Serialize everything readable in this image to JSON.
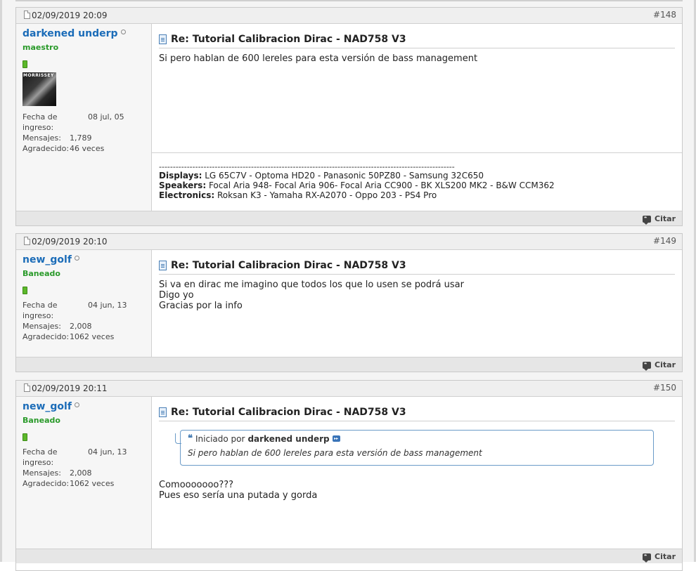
{
  "posts": [
    {
      "date": "02/09/2019 20:09",
      "number": "#148",
      "username": "darkened underp",
      "rank": "maestro",
      "info": [
        {
          "label": "Fecha de ingreso:",
          "value": "08 jul, 05"
        },
        {
          "label": "Mensajes:",
          "value": "1,789"
        },
        {
          "label": "Agradecido:",
          "value": "46 veces"
        }
      ],
      "avatar_text": "MORRISSEY",
      "title": "Re: Tutorial Calibracion Dirac - NAD758 V3",
      "message": [
        "Si pero hablan de 600 lereles para esta versión de bass management"
      ],
      "signature": {
        "divider": "----------------------------------------------------------------------------------------------------------",
        "lines": [
          {
            "label": "Displays:",
            "value": "LG 65C7V - Optoma HD20 - Panasonic 50PZ80 - Samsung 32C650"
          },
          {
            "label": "Speakers:",
            "value": "Focal Aria 948- Focal Aria 906- Focal Aria CC900 - BK XLS200 MK2 - B&W CCM362"
          },
          {
            "label": "Electronics:",
            "value": "Roksan K3 - Yamaha RX-A2070 - Oppo 203 - PS4 Pro"
          }
        ]
      },
      "cite": "Citar"
    },
    {
      "date": "02/09/2019 20:10",
      "number": "#149",
      "username": "new_golf",
      "rank": "Baneado",
      "info": [
        {
          "label": "Fecha de ingreso:",
          "value": "04 jun, 13"
        },
        {
          "label": "Mensajes:",
          "value": "2,008"
        },
        {
          "label": "Agradecido:",
          "value": "1062 veces"
        }
      ],
      "title": "Re: Tutorial Calibracion Dirac - NAD758 V3",
      "message": [
        "Si va en dirac me imagino que todos los que lo usen se podrá usar",
        "Digo yo",
        "Gracias por la info"
      ],
      "cite": "Citar"
    },
    {
      "date": "02/09/2019 20:11",
      "number": "#150",
      "username": "new_golf",
      "rank": "Baneado",
      "info": [
        {
          "label": "Fecha de ingreso:",
          "value": "04 jun, 13"
        },
        {
          "label": "Mensajes:",
          "value": "2,008"
        },
        {
          "label": "Agradecido:",
          "value": "1062 veces"
        }
      ],
      "title": "Re: Tutorial Calibracion Dirac - NAD758 V3",
      "quote": {
        "prefix": "Iniciado por",
        "author": "darkened underp",
        "text": "Si pero hablan de 600 lereles para esta versión de bass management"
      },
      "message": [
        "Comooooooo???",
        "Pues eso sería una putada y gorda"
      ],
      "cite": "Citar"
    }
  ],
  "colors": {
    "username": "#1b6cb8",
    "rank": "#2a9a2a",
    "quote_border": "#6a9bc8"
  },
  "icons": [
    "document-icon",
    "quote-icon",
    "goto-post-icon",
    "cite-icon",
    "status-offline-icon",
    "reputation-icon"
  ]
}
